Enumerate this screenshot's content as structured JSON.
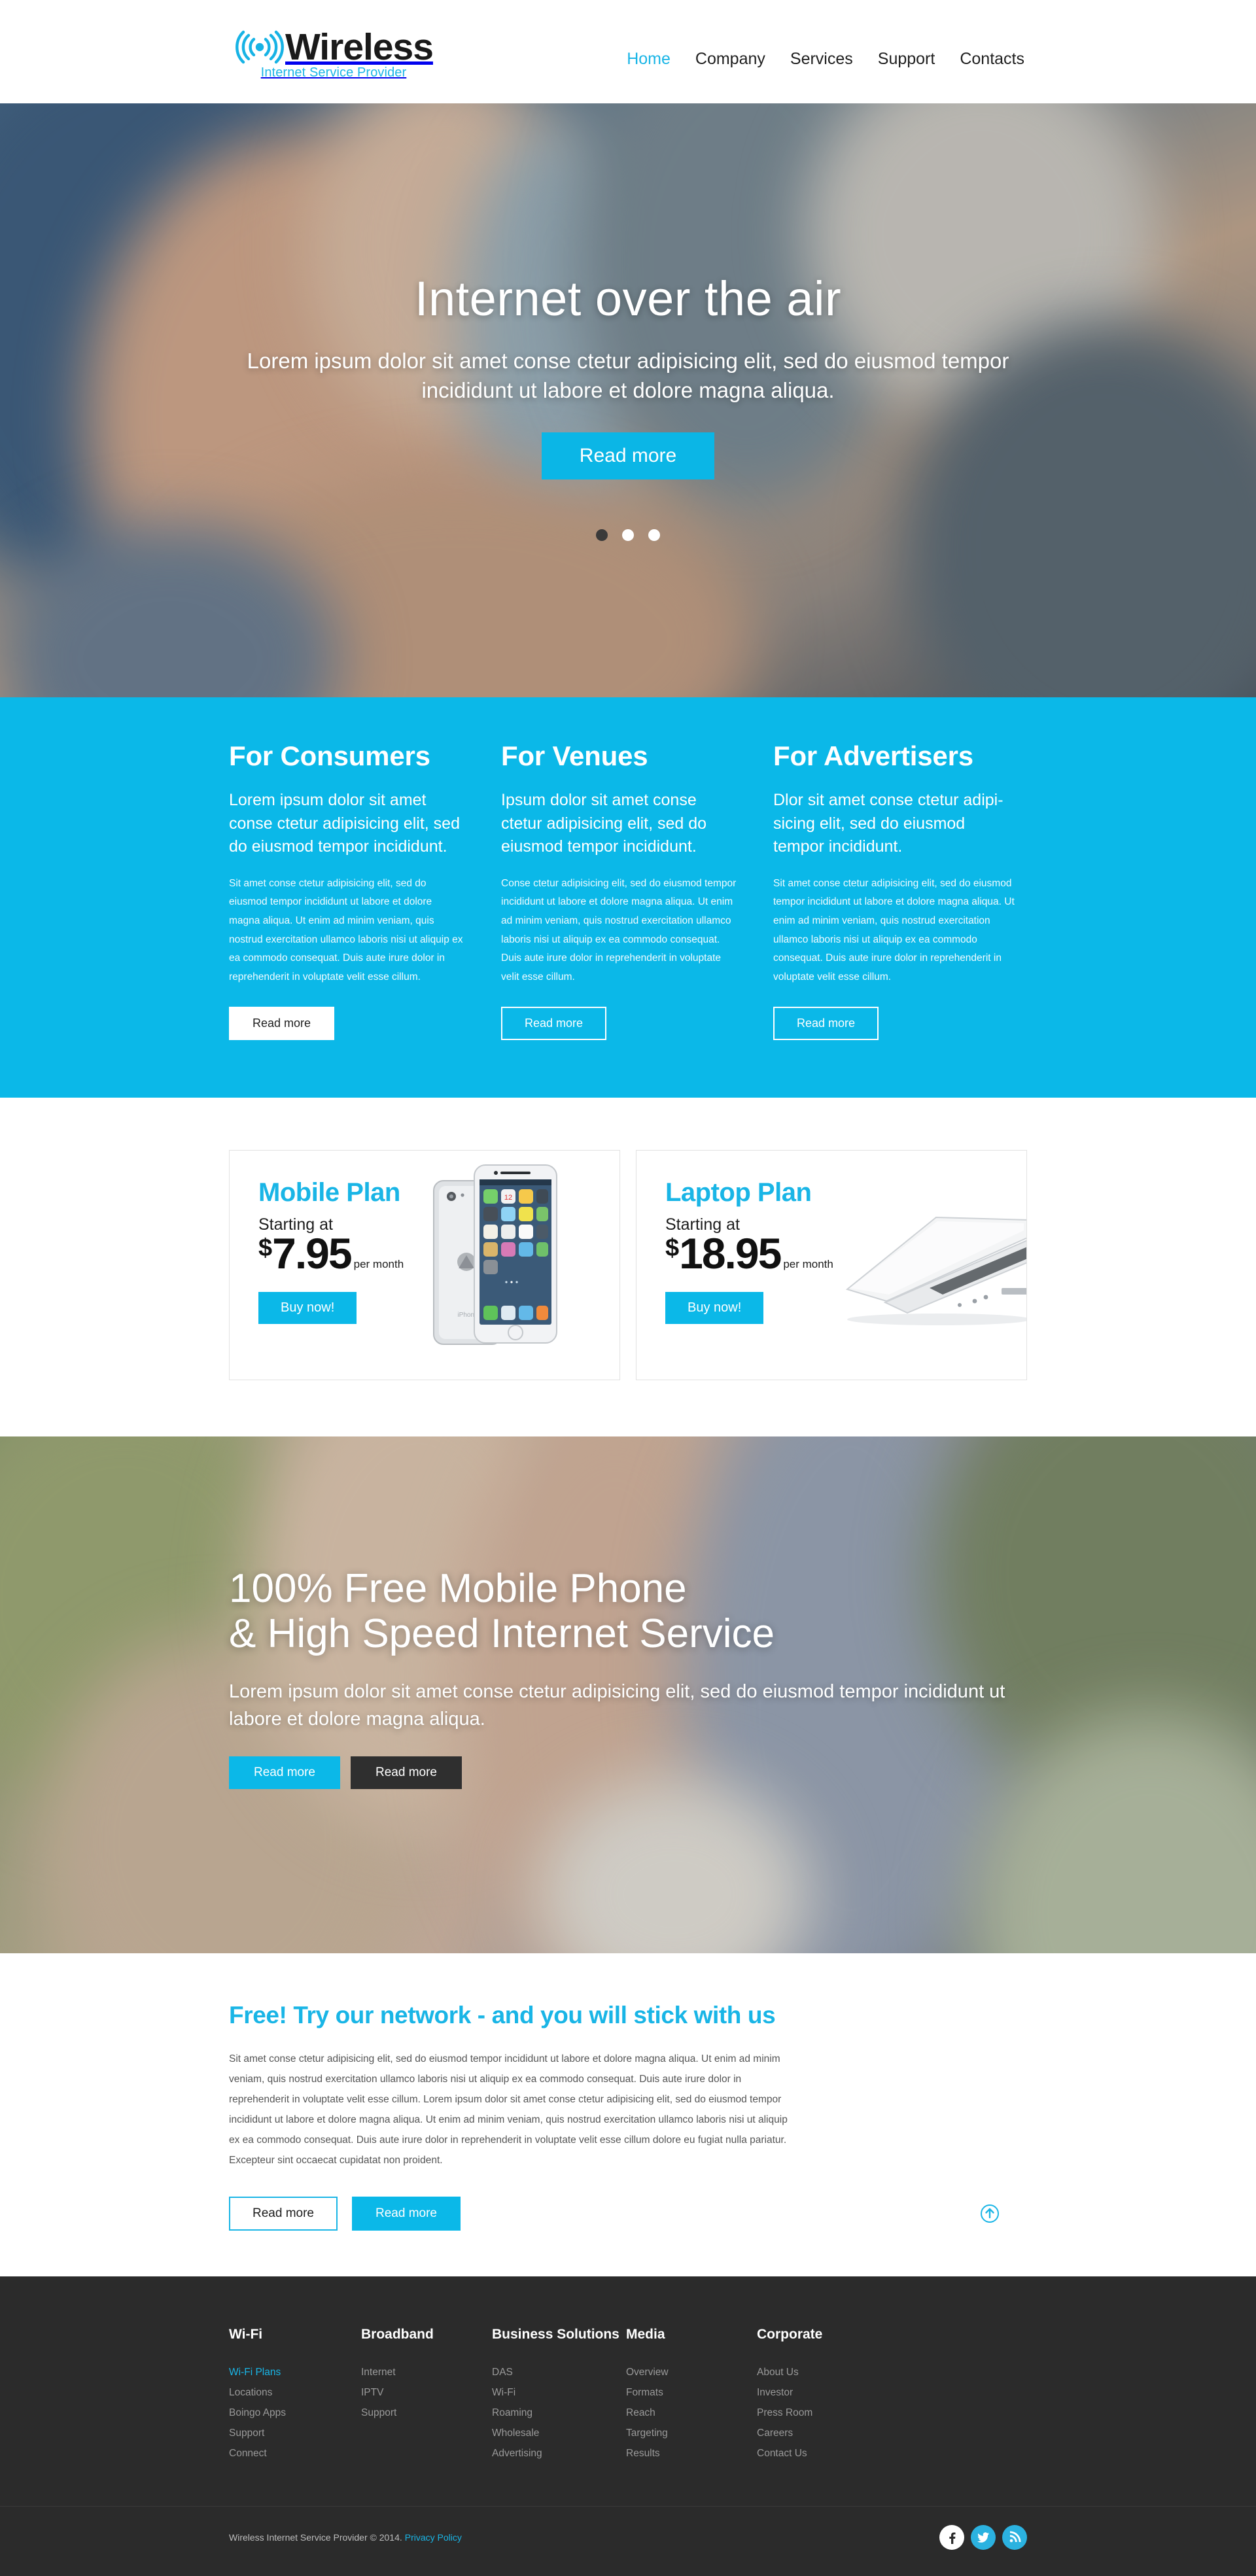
{
  "brand": {
    "name": "Wireless",
    "tagline": "Internet Service Provider",
    "icon": "wifi-signal-icon",
    "accent": "#0bb8e8",
    "dark": "#2b2b2b"
  },
  "nav": {
    "items": [
      {
        "label": "Home",
        "active": true
      },
      {
        "label": "Company",
        "active": false
      },
      {
        "label": "Services",
        "active": false
      },
      {
        "label": "Support",
        "active": false
      },
      {
        "label": "Contacts",
        "active": false
      }
    ]
  },
  "hero": {
    "title": "Internet over the air",
    "subtitle": "Lorem ipsum dolor sit amet conse ctetur adipisicing elit, sed do eiusmod tempor incididunt ut labore et dolore magna aliqua.",
    "button": "Read more",
    "slides": 3,
    "active_slide": 1
  },
  "features": {
    "columns": [
      {
        "heading": "For Consumers",
        "lead": "Lorem ipsum dolor sit amet conse ctetur adipisicing elit, sed do eiusmod tempor incididunt.",
        "body": "Sit amet conse ctetur adipisicing elit, sed do eiusmod tempor incididunt ut labore et dolore magna aliqua. Ut enim ad minim veniam, quis nostrud exercitation ullamco laboris nisi ut aliquip ex ea commodo consequat. Duis aute irure dolor in reprehenderit in voluptate velit esse cillum.",
        "button": "Read more",
        "button_style": "solid"
      },
      {
        "heading": "For Venues",
        "lead": "Ipsum dolor sit amet conse ctetur adipisicing elit, sed do eiusmod tempor incididunt.",
        "body": "Conse ctetur adipisicing elit, sed do eiusmod tempor incididunt ut labore et dolore magna aliqua. Ut enim ad minim veniam, quis nostrud exercitation ullamco laboris nisi ut aliquip ex ea commodo consequat. Duis aute irure dolor in reprehenderit in voluptate velit esse cillum.",
        "button": "Read more",
        "button_style": "outline"
      },
      {
        "heading": "For Advertisers",
        "lead": "Dlor sit amet conse ctetur adipi-sicing elit, sed do eiusmod tempor incididunt.",
        "body": "Sit amet conse ctetur adipisicing elit, sed do eiusmod tempor incididunt ut labore et dolore magna aliqua. Ut enim ad minim veniam, quis nostrud exercitation ullamco laboris nisi ut aliquip ex ea commodo consequat. Duis aute irure dolor in reprehenderit in voluptate velit esse cillum.",
        "button": "Read more",
        "button_style": "outline"
      }
    ]
  },
  "plans": [
    {
      "title": "Mobile Plan",
      "starting_label": "Starting at",
      "currency": "$",
      "amount": "7.95",
      "period": "per month",
      "button": "Buy now!",
      "art": "smartphone-image"
    },
    {
      "title": "Laptop Plan",
      "starting_label": "Starting at",
      "currency": "$",
      "amount": "18.95",
      "period": "per month",
      "button": "Buy now!",
      "art": "laptop-image"
    }
  ],
  "banner": {
    "title_line1": "100% Free Mobile Phone",
    "title_line2": "& High Speed Internet Service",
    "subtitle": "Lorem ipsum dolor sit amet conse ctetur adipisicing elit, sed do eiusmod tempor incididunt ut labore et dolore magna aliqua.",
    "button_primary": "Read more",
    "button_secondary": "Read more"
  },
  "intro": {
    "title": "Free! Try our network - and you will stick with us",
    "body": "Sit amet conse ctetur adipisicing elit, sed do eiusmod tempor incididunt ut labore et dolore magna aliqua. Ut enim ad minim veniam, quis nostrud exercitation ullamco laboris nisi ut aliquip ex ea commodo consequat. Duis aute irure dolor in reprehenderit in voluptate velit esse cillum. Lorem ipsum dolor sit amet conse ctetur adipisicing elit, sed do eiusmod tempor incididunt ut labore et dolore magna aliqua. Ut enim ad minim veniam, quis nostrud exercitation ullamco laboris nisi ut aliquip ex ea commodo consequat. Duis aute irure dolor in reprehenderit in voluptate velit esse cillum dolore eu fugiat nulla pariatur. Excepteur sint occaecat cupidatat non proident.",
    "button_ghost": "Read more",
    "button_solid": "Read more",
    "scroll_top_icon": "arrow-up-circle-icon"
  },
  "footer": {
    "columns": [
      {
        "heading": "Wi-Fi",
        "links": [
          {
            "label": "Wi-Fi Plans",
            "active": true
          },
          {
            "label": "Locations",
            "active": false
          },
          {
            "label": "Boingo Apps",
            "active": false
          },
          {
            "label": "Support",
            "active": false
          },
          {
            "label": "Connect",
            "active": false
          }
        ]
      },
      {
        "heading": "Broadband",
        "links": [
          {
            "label": "Internet",
            "active": false
          },
          {
            "label": "IPTV",
            "active": false
          },
          {
            "label": "Support",
            "active": false
          }
        ]
      },
      {
        "heading": "Business Solutions",
        "links": [
          {
            "label": "DAS",
            "active": false
          },
          {
            "label": "Wi-Fi",
            "active": false
          },
          {
            "label": "Roaming",
            "active": false
          },
          {
            "label": "Wholesale",
            "active": false
          },
          {
            "label": "Advertising",
            "active": false
          }
        ]
      },
      {
        "heading": "Media",
        "links": [
          {
            "label": "Overview",
            "active": false
          },
          {
            "label": "Formats",
            "active": false
          },
          {
            "label": "Reach",
            "active": false
          },
          {
            "label": "Targeting",
            "active": false
          },
          {
            "label": "Results",
            "active": false
          }
        ]
      },
      {
        "heading": "Corporate",
        "links": [
          {
            "label": "About Us",
            "active": false
          },
          {
            "label": "Investor",
            "active": false
          },
          {
            "label": "Press Room",
            "active": false
          },
          {
            "label": "Careers",
            "active": false
          },
          {
            "label": "Contact Us",
            "active": false
          }
        ]
      }
    ],
    "copyright": "Wireless Internet Service Provider © 2014.",
    "privacy_label": "Privacy Policy",
    "socials": [
      {
        "name": "facebook-icon",
        "glyph": "f"
      },
      {
        "name": "twitter-icon",
        "glyph": "t"
      },
      {
        "name": "rss-icon",
        "glyph": "r"
      }
    ]
  }
}
